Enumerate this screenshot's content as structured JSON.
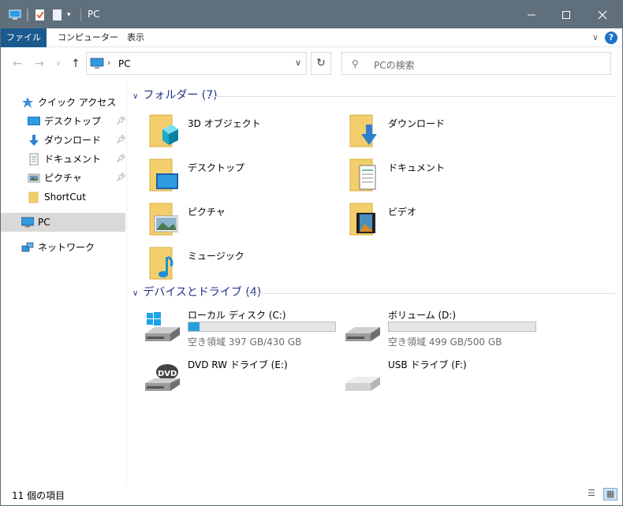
{
  "window": {
    "title": "PC"
  },
  "ribbon": {
    "tabs": [
      "ファイル",
      "コンピューター",
      "表示"
    ],
    "help": "?"
  },
  "nav": {
    "address": "PC",
    "search_placeholder": "PCの検索"
  },
  "sidebar": {
    "items": [
      {
        "label": "クイック アクセス",
        "icon": "star-icon"
      },
      {
        "label": "デスクトップ",
        "icon": "desktop-icon",
        "pinned": true
      },
      {
        "label": "ダウンロード",
        "icon": "download-icon",
        "pinned": true
      },
      {
        "label": "ドキュメント",
        "icon": "document-icon",
        "pinned": true
      },
      {
        "label": "ピクチャ",
        "icon": "picture-icon",
        "pinned": true
      },
      {
        "label": "ShortCut",
        "icon": "folder-icon"
      },
      {
        "label": "PC",
        "icon": "pc-icon",
        "selected": true
      },
      {
        "label": "ネットワーク",
        "icon": "network-icon"
      }
    ]
  },
  "folders": {
    "header": "フォルダー (7)",
    "items": [
      {
        "label": "3D オブジェクト",
        "icon": "3d-objects-folder-icon"
      },
      {
        "label": "ダウンロード",
        "icon": "downloads-folder-icon"
      },
      {
        "label": "デスクトップ",
        "icon": "desktop-folder-icon"
      },
      {
        "label": "ドキュメント",
        "icon": "documents-folder-icon"
      },
      {
        "label": "ピクチャ",
        "icon": "pictures-folder-icon"
      },
      {
        "label": "ビデオ",
        "icon": "videos-folder-icon"
      },
      {
        "label": "ミュージック",
        "icon": "music-folder-icon"
      }
    ]
  },
  "drives": {
    "header": "デバイスとドライブ (4)",
    "items": [
      {
        "label": "ローカル ディスク (C:)",
        "free": "空き領域 397 GB/430 GB",
        "used_fraction": 0.077,
        "icon": "windows-drive-icon"
      },
      {
        "label": "ボリューム (D:)",
        "free": "空き領域 499 GB/500 GB",
        "used_fraction": 0.002,
        "icon": "hard-drive-icon"
      },
      {
        "label": "DVD RW ドライブ (E:)",
        "icon": "dvd-drive-icon",
        "badge": "DVD"
      },
      {
        "label": "USB ドライブ (F:)",
        "icon": "usb-drive-icon"
      }
    ]
  },
  "status": {
    "count": "11 個の項目"
  },
  "colors": {
    "titlebar": "#5f6f7c",
    "file_tab": "#1b5a8e",
    "group_header": "#1e3287",
    "usage_bar": "#26a0da",
    "folder": "#f3cf6b"
  }
}
